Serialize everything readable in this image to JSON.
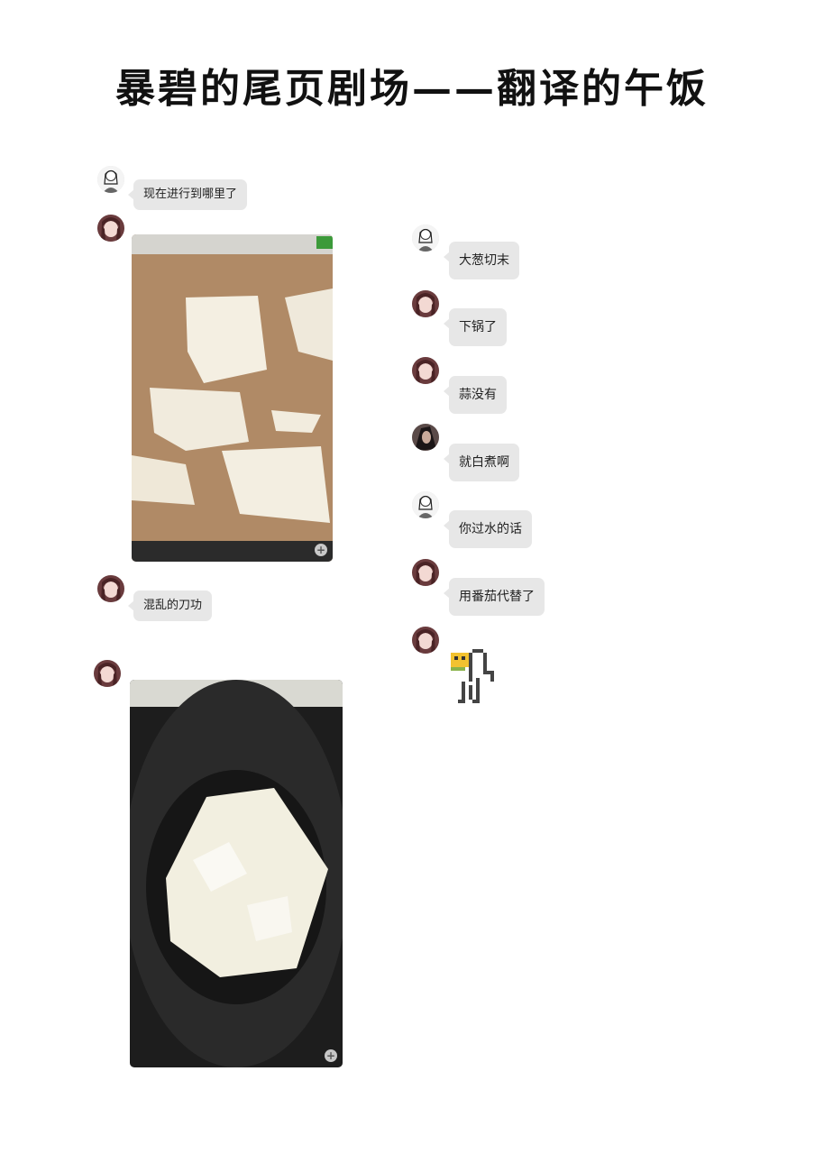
{
  "page": {
    "title": "暴碧的尾页剧场——翻译的午饭"
  },
  "messages_left": [
    {
      "type": "text",
      "avatar": "avatar-sketch",
      "text": "现在进行到哪里了"
    },
    {
      "type": "image",
      "avatar": "avatar-girl",
      "image": "tofu-on-cutting-board-photo"
    },
    {
      "type": "text",
      "avatar": "avatar-girl",
      "text": "混乱的刀功"
    },
    {
      "type": "image",
      "avatar": "avatar-girl",
      "image": "tofu-in-wok-photo"
    }
  ],
  "messages_right": [
    {
      "type": "text",
      "avatar": "avatar-sketch",
      "text": "大葱切末"
    },
    {
      "type": "text",
      "avatar": "avatar-girl",
      "text": "下锅了"
    },
    {
      "type": "text",
      "avatar": "avatar-girl",
      "text": "蒜没有"
    },
    {
      "type": "text",
      "avatar": "avatar-dark",
      "text": "就白煮啊"
    },
    {
      "type": "text",
      "avatar": "avatar-sketch",
      "text": "你过水的话"
    },
    {
      "type": "text",
      "avatar": "avatar-girl",
      "text": "用番茄代替了"
    },
    {
      "type": "sticker",
      "avatar": "avatar-girl",
      "sticker": "pixel-cat-sticker"
    }
  ],
  "colors": {
    "bubble": "#e7e7e7",
    "text": "#222222",
    "background": "#ffffff"
  }
}
